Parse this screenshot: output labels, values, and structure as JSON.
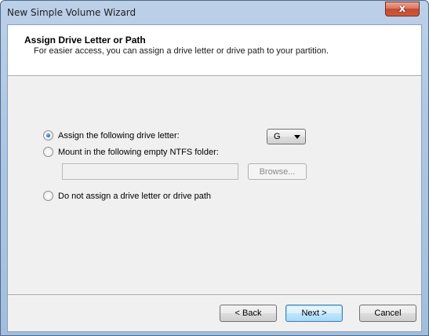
{
  "window": {
    "title": "New Simple Volume Wizard",
    "close_glyph": "x"
  },
  "header": {
    "title": "Assign Drive Letter or Path",
    "subtitle": "For easier access, you can assign a drive letter or drive path to your partition."
  },
  "options": {
    "assign_letter": {
      "label": "Assign the following drive letter:",
      "checked": true
    },
    "mount_folder": {
      "label": "Mount in the following empty NTFS folder:",
      "checked": false,
      "input_value": "",
      "browse_label": "Browse..."
    },
    "no_assign": {
      "label": "Do not assign a drive letter or drive path",
      "checked": false
    }
  },
  "drive_letter": {
    "selected": "G"
  },
  "footer": {
    "back_label": "< Back",
    "next_label": "Next >",
    "cancel_label": "Cancel"
  },
  "colors": {
    "close_button": "#c24a30",
    "default_button": "#3c7fb1",
    "selected_radio": "#2566c4"
  }
}
